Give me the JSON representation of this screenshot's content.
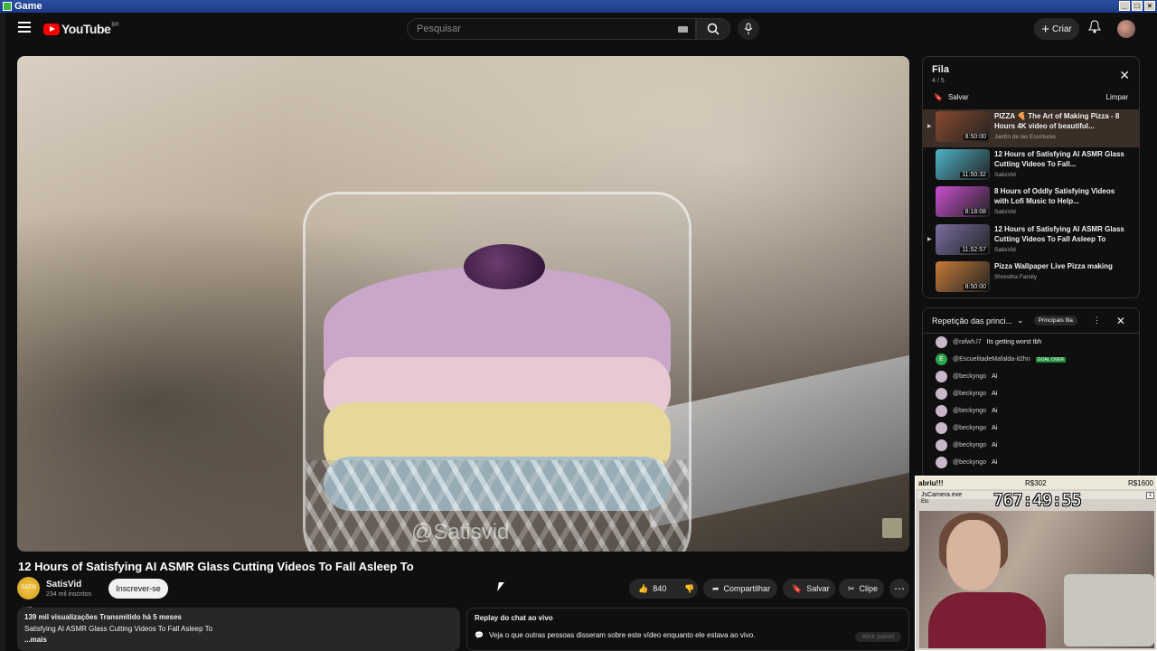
{
  "window": {
    "title": "Game"
  },
  "header": {
    "logo_text": "YouTube",
    "logo_country": "BR",
    "search_placeholder": "Pesquisar",
    "create_label": "Criar"
  },
  "video": {
    "watermark": "@Satisvid",
    "title": "12 Hours of Satisfying AI ASMR Glass Cutting Videos To Fall Asleep To",
    "channel": "SatisVid",
    "channel_avatar_text": "SATIS VID",
    "subscribers": "234 mil inscritos",
    "subscribe_label": "Inscrever-se",
    "likes": "840",
    "share_label": "Compartilhar",
    "save_label": "Salvar",
    "clip_label": "Clipe",
    "views_line": "139 mil visualizações  Transmitido há 5 meses",
    "description": "Satisfying AI ASMR Glass Cutting Videos To Fall Asleep To",
    "more_label": "...mais"
  },
  "chat_replay": {
    "title": "Replay do chat ao vivo",
    "description": "Veja o que outras pessoas disseram sobre este vídeo enquanto ele estava ao vivo.",
    "open_label": "Abrir painel"
  },
  "queue": {
    "title": "Fila",
    "count": "4 / 5",
    "save_label": "Salvar",
    "clear_label": "Limpar",
    "items": [
      {
        "title": "PIZZA 🍕 The Art of Making Pizza - 8 Hours 4K video of beautiful...",
        "channel": "Jardín de las Escrituras",
        "duration": "8:50:00",
        "thumb": "#8a4a2e"
      },
      {
        "title": "12 Hours of Satisfying AI ASMR Glass Cutting Videos To Fall...",
        "channel": "SatisVid",
        "duration": "11:50:32",
        "thumb": "#4fb3c9"
      },
      {
        "title": "8 Hours of Oddly Satisfying Videos with Lofi Music to Help...",
        "channel": "SatisVid",
        "duration": "8:18:08",
        "thumb": "#c94fd0"
      },
      {
        "title": "12 Hours of Satisfying AI ASMR Glass Cutting Videos To Fall Asleep To",
        "channel": "SatisVid",
        "duration": "11:52:57",
        "thumb": "#7a6ea0"
      },
      {
        "title": "Pizza Wallpaper Live Pizza making",
        "channel": "Shrestha Family",
        "duration": "8:50:00",
        "thumb": "#c97a3a"
      }
    ]
  },
  "live_chat": {
    "mode_label": "Repetição das princi...",
    "chip_label": "Principais fila",
    "messages": [
      {
        "user": "@rafwh.l7",
        "text": "Its getting worst tbh"
      },
      {
        "user": "@EscuelitadeMafalda-it2hn",
        "text": "",
        "badge": "GOAL OVER"
      },
      {
        "user": "@beckyngo",
        "text": "Ai"
      },
      {
        "user": "@beckyngo",
        "text": "Ai"
      },
      {
        "user": "@beckyngo",
        "text": "Ai"
      },
      {
        "user": "@beckyngo",
        "text": "Ai"
      },
      {
        "user": "@beckyngo",
        "text": "Ai"
      },
      {
        "user": "@beckyngo",
        "text": "Ai"
      }
    ]
  },
  "overlay": {
    "left": "abriu!!!",
    "mid": "R$302",
    "right": "R$1600",
    "window_title": "JsCamera.exe",
    "menu": "Etc",
    "timer": "767:49:55"
  }
}
